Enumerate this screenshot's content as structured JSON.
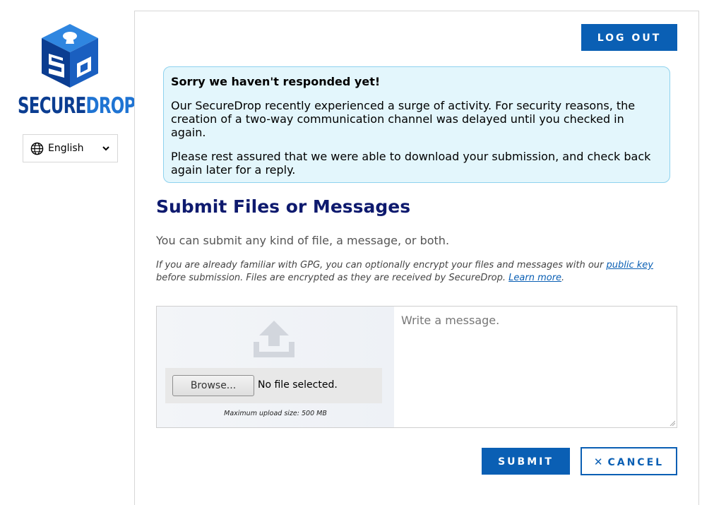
{
  "app": {
    "logo_text_secure": "SECURE",
    "logo_text_drop": "DROP",
    "logo_icon": "securedrop-cube-logo"
  },
  "language": {
    "selected": "English",
    "icon": "globe-icon"
  },
  "header": {
    "logout_label": "LOG OUT"
  },
  "notice": {
    "title": "Sorry we haven't responded yet!",
    "paragraph1": "Our SecureDrop recently experienced a surge of activity. For security reasons, the creation of a two-way communication channel was delayed until you checked in again.",
    "paragraph2": "Please rest assured that we were able to download your submission, and check back again later for a reply."
  },
  "main": {
    "heading": "Submit Files or Messages",
    "lead": "You can submit any kind of file, a message, or both.",
    "gpg_note_part1": "If you are already familiar with GPG, you can optionally encrypt your files and messages with our ",
    "public_key_link": "public key",
    "gpg_note_part2": " before submission. Files are encrypted as they are received by SecureDrop. ",
    "learn_more_link": "Learn more",
    "gpg_note_end": "."
  },
  "upload": {
    "icon": "upload-icon",
    "browse_label": "Browse...",
    "file_status": "No file selected.",
    "max_size": "Maximum upload size: 500 MB"
  },
  "message": {
    "placeholder": "Write a message.",
    "value": ""
  },
  "actions": {
    "submit_label": "SUBMIT",
    "cancel_icon": "✕",
    "cancel_label": "CANCEL"
  },
  "colors": {
    "primary": "#0a5fb4",
    "heading": "#0e1a6e",
    "notice_bg": "#e3f6fc",
    "notice_border": "#8fd2ee"
  }
}
